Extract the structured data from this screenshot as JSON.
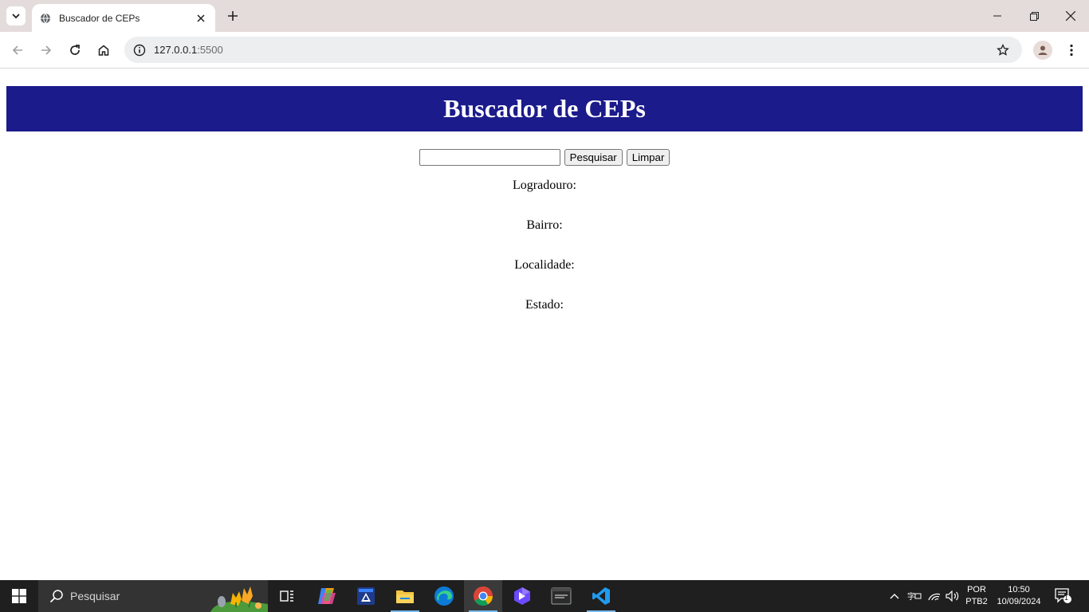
{
  "browser": {
    "tab_title": "Buscador de CEPs",
    "url_host": "127.0.0.1",
    "url_port": ":5500"
  },
  "page": {
    "title": "Buscador de CEPs",
    "cep_input_value": "",
    "search_button": "Pesquisar",
    "clear_button": "Limpar",
    "fields": {
      "logradouro": "Logradouro:",
      "bairro": "Bairro:",
      "localidade": "Localidade:",
      "estado": "Estado:"
    }
  },
  "colors": {
    "header_bg": "#1b1b8c",
    "header_text": "#ffffff",
    "tabstrip_bg": "#e4dcdb",
    "taskbar_bg": "#1f1f1f"
  },
  "taskbar": {
    "search_placeholder": "Pesquisar",
    "apps": [
      "task-view",
      "copilot",
      "app-installer",
      "file-explorer",
      "edge",
      "chrome",
      "dev-app",
      "mysql-workbench",
      "vscode"
    ],
    "language_top": "POR",
    "language_bottom": "PTB2",
    "time": "10:50",
    "date": "10/09/2024",
    "notification_count": "1"
  }
}
